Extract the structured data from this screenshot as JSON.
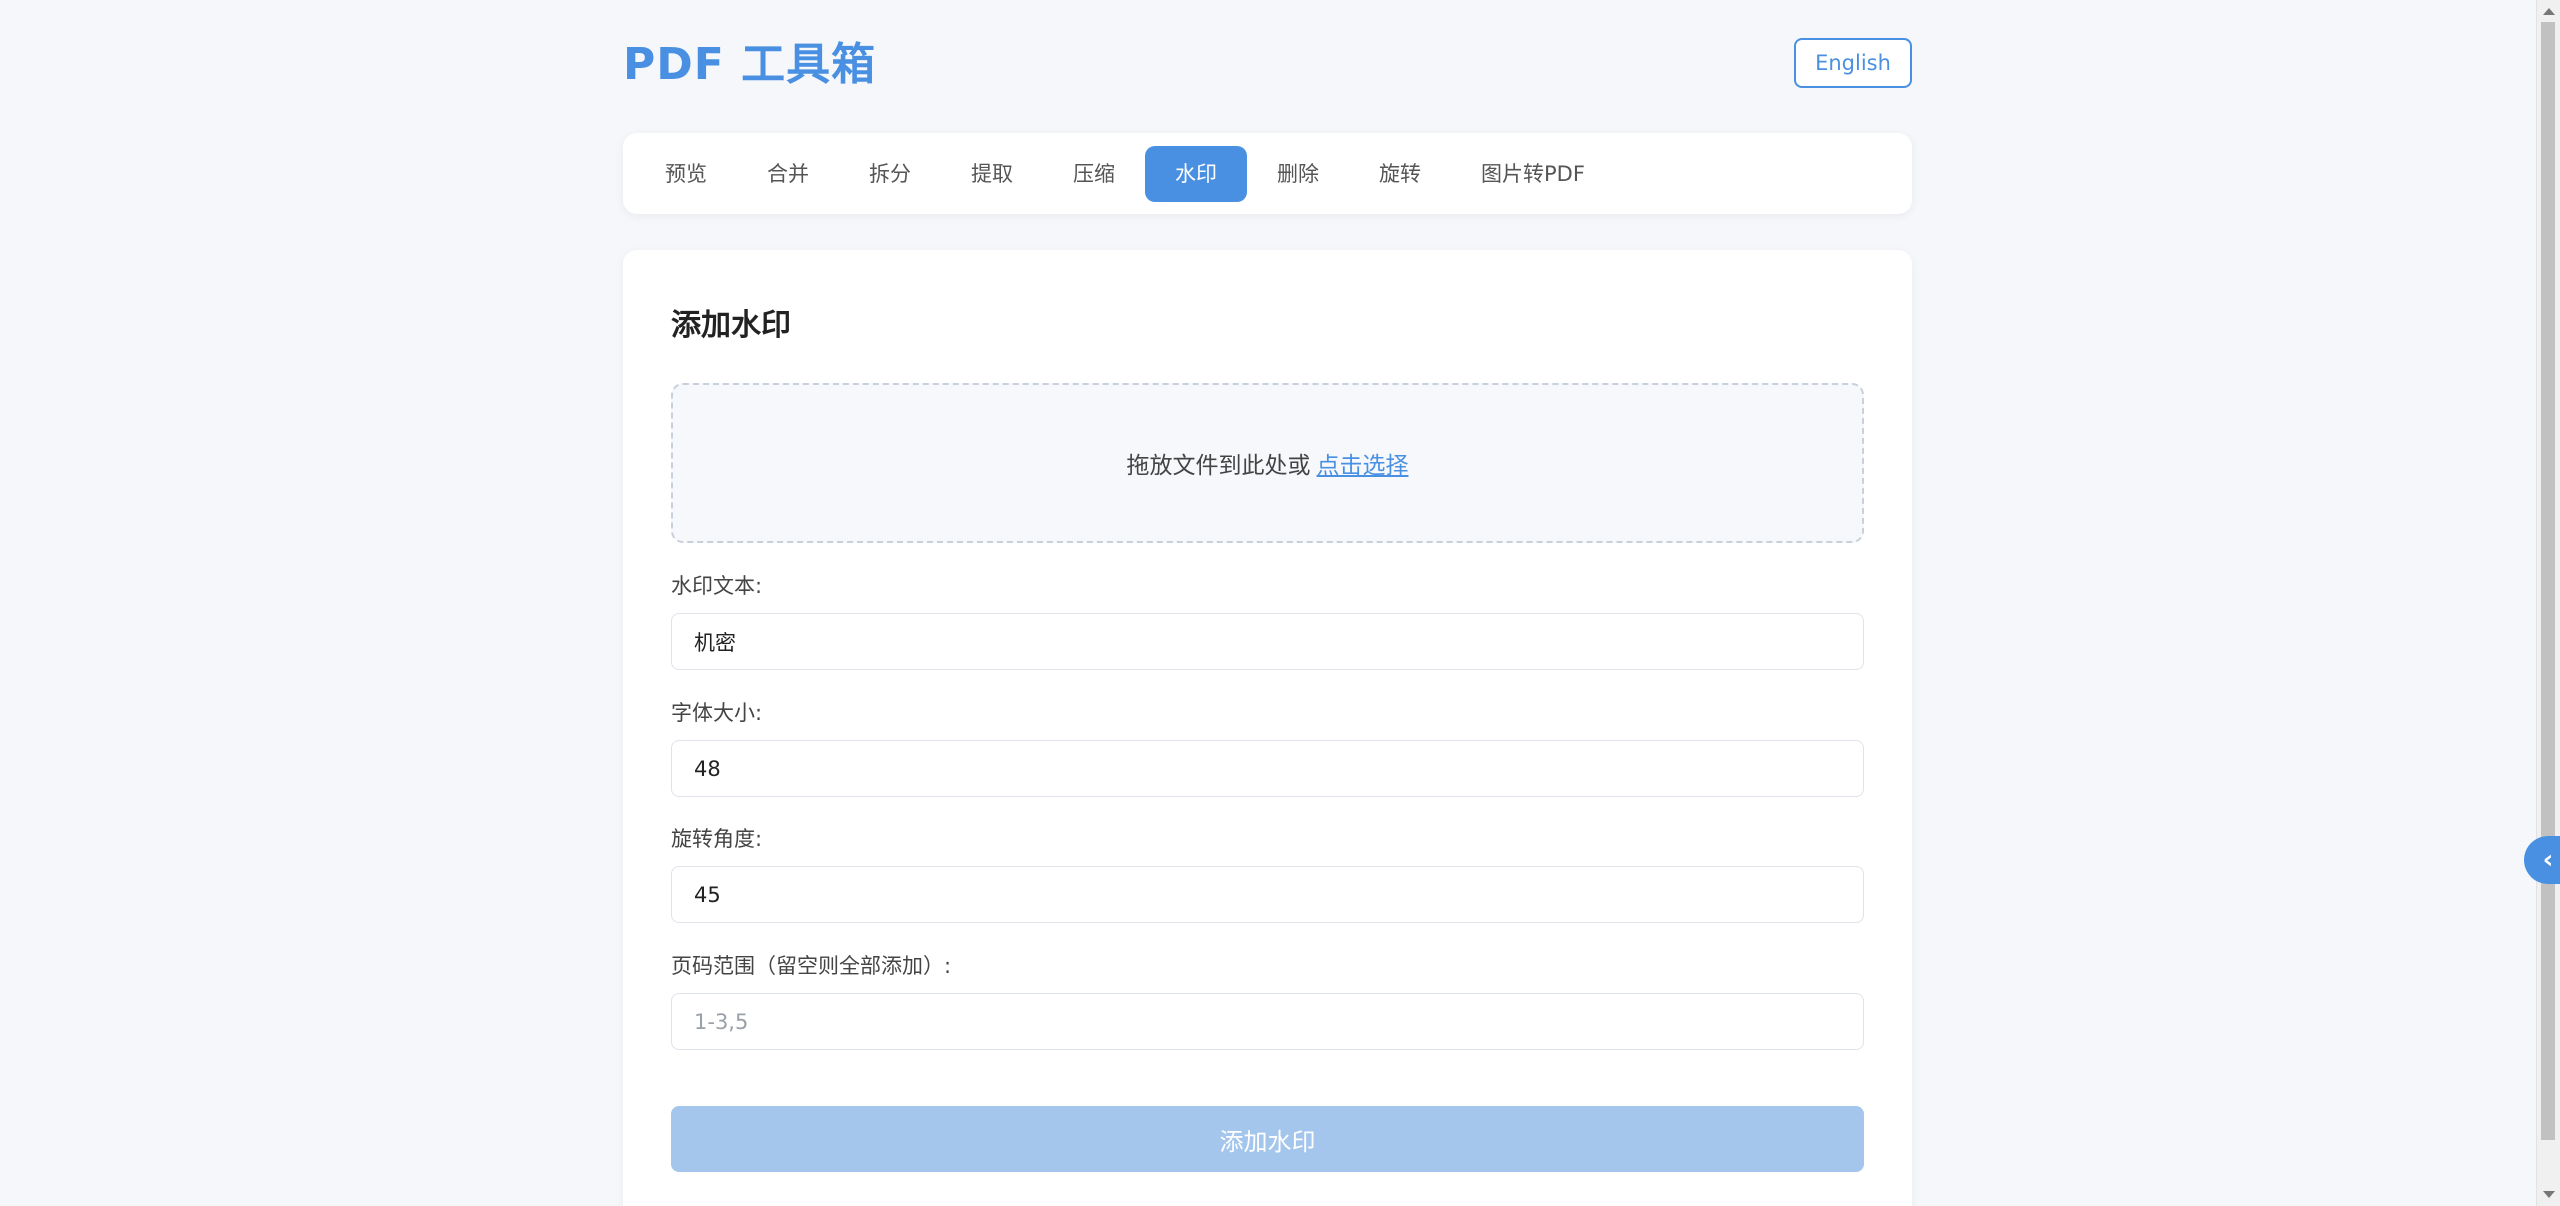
{
  "header": {
    "title": "PDF 工具箱",
    "lang_button": "English"
  },
  "tabs": [
    {
      "label": "预览",
      "active": false
    },
    {
      "label": "合并",
      "active": false
    },
    {
      "label": "拆分",
      "active": false
    },
    {
      "label": "提取",
      "active": false
    },
    {
      "label": "压缩",
      "active": false
    },
    {
      "label": "水印",
      "active": true
    },
    {
      "label": "删除",
      "active": false
    },
    {
      "label": "旋转",
      "active": false
    },
    {
      "label": "图片转PDF",
      "active": false
    }
  ],
  "panel": {
    "title": "添加水印",
    "dropzone": {
      "text": "拖放文件到此处或",
      "link": "点击选择"
    },
    "fields": {
      "watermark_text": {
        "label": "水印文本:",
        "value": "机密"
      },
      "font_size": {
        "label": "字体大小:",
        "value": "48"
      },
      "rotation": {
        "label": "旋转角度:",
        "value": "45"
      },
      "page_range": {
        "label": "页码范围（留空则全部添加）:",
        "value": "",
        "placeholder": "1-3,5"
      }
    },
    "submit_label": "添加水印"
  },
  "side_toggle": {
    "icon": "chevron-left-icon",
    "glyph": "‹"
  },
  "colors": {
    "accent": "#4a90e2",
    "disabled_button": "#a4c6ec",
    "background": "#f5f7fa"
  }
}
